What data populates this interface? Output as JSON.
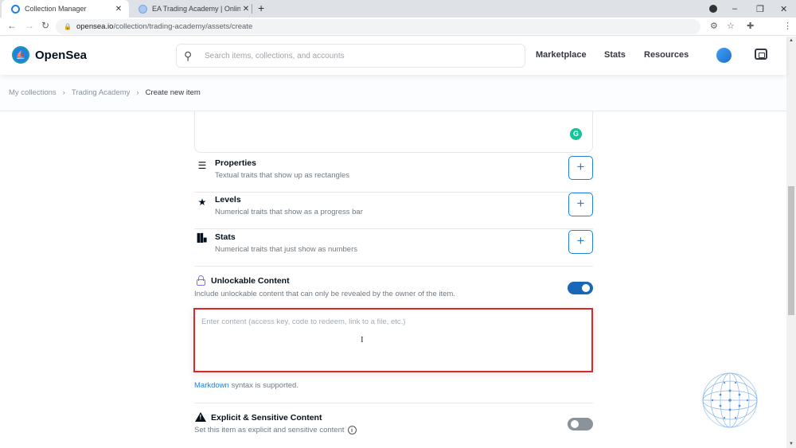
{
  "browser": {
    "tabs": [
      {
        "title": "Collection Manager",
        "active": true
      },
      {
        "title": "EA Trading Academy | Online Co",
        "active": false
      }
    ],
    "new_tab": "+",
    "url_host": "opensea.io",
    "url_path": "/collection/trading-academy/assets/create",
    "window_controls": {
      "minimize": "–",
      "restore": "❐",
      "close": "✕"
    }
  },
  "header": {
    "logo_text": "OpenSea",
    "search_placeholder": "Search items, collections, and accounts",
    "nav": [
      "Marketplace",
      "Stats",
      "Resources"
    ]
  },
  "breadcrumb": {
    "items": [
      "My collections",
      "Trading Academy"
    ],
    "current": "Create new item",
    "separator": "›"
  },
  "traits": [
    {
      "icon": "list-icon",
      "glyph": "☰",
      "name": "Properties",
      "description": "Textual traits that show up as rectangles",
      "add": "+"
    },
    {
      "icon": "star-icon",
      "glyph": "★",
      "name": "Levels",
      "description": "Numerical traits that show as a progress bar",
      "add": "+"
    },
    {
      "icon": "bar-chart-icon",
      "glyph": "▮",
      "name": "Stats",
      "description": "Numerical traits that just show as numbers",
      "add": "+"
    }
  ],
  "unlockable": {
    "title": "Unlockable Content",
    "description": "Include unlockable content that can only be revealed by the owner of the item.",
    "enabled": true,
    "placeholder": "Enter content (access key, code to redeem, link to a file, etc.)",
    "value": ""
  },
  "markdown_note": {
    "link": "Markdown",
    "text": " syntax is supported."
  },
  "explicit": {
    "title": "Explicit & Sensitive Content",
    "description": "Set this item as explicit and sensitive content",
    "enabled": false,
    "info_glyph": "i"
  },
  "grammarly_glyph": "G"
}
